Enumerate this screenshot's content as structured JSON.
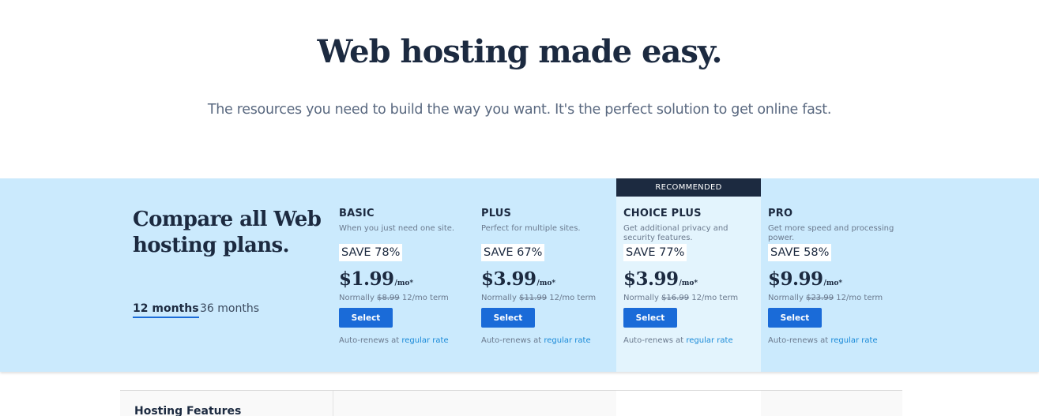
{
  "hero": {
    "title": "Web hosting made easy.",
    "subtitle": "The resources you need to build the way you want. It's the perfect solution to get online fast."
  },
  "compare": {
    "title": "Compare all Web hosting plans.",
    "terms": [
      {
        "label": "12 months",
        "active": true
      },
      {
        "label": "36 months",
        "active": false
      }
    ]
  },
  "recommended_label": "RECOMMENDED",
  "plans": [
    {
      "name": "BASIC",
      "description": "When you just need one site.",
      "save": "SAVE 78%",
      "price": "$1.99",
      "per": "/mo*",
      "normally_prefix": "Normally",
      "normal_price": "$8.99",
      "term": "12/mo term",
      "button": "Select",
      "renew_prefix": "Auto-renews at",
      "renew_link": "regular rate"
    },
    {
      "name": "PLUS",
      "description": "Perfect for multiple sites.",
      "save": "SAVE 67%",
      "price": "$3.99",
      "per": "/mo*",
      "normally_prefix": "Normally",
      "normal_price": "$11.99",
      "term": "12/mo term",
      "button": "Select",
      "renew_prefix": "Auto-renews at",
      "renew_link": "regular rate"
    },
    {
      "name": "CHOICE PLUS",
      "description": "Get additional privacy and security features.",
      "save": "SAVE 77%",
      "price": "$3.99",
      "per": "/mo*",
      "normally_prefix": "Normally",
      "normal_price": "$16.99",
      "term": "12/mo term",
      "button": "Select",
      "renew_prefix": "Auto-renews at",
      "renew_link": "regular rate"
    },
    {
      "name": "PRO",
      "description": "Get more speed and processing power.",
      "save": "SAVE 58%",
      "price": "$9.99",
      "per": "/mo*",
      "normally_prefix": "Normally",
      "normal_price": "$23.99",
      "term": "12/mo term",
      "button": "Select",
      "renew_prefix": "Auto-renews at",
      "renew_link": "regular rate"
    }
  ],
  "features": {
    "heading": "Hosting Features"
  },
  "colors": {
    "navy": "#1c2a40",
    "band": "#cbeafd",
    "highlight": "#e3f4fd",
    "button": "#1a6bd8",
    "link": "#1a8ad8"
  }
}
